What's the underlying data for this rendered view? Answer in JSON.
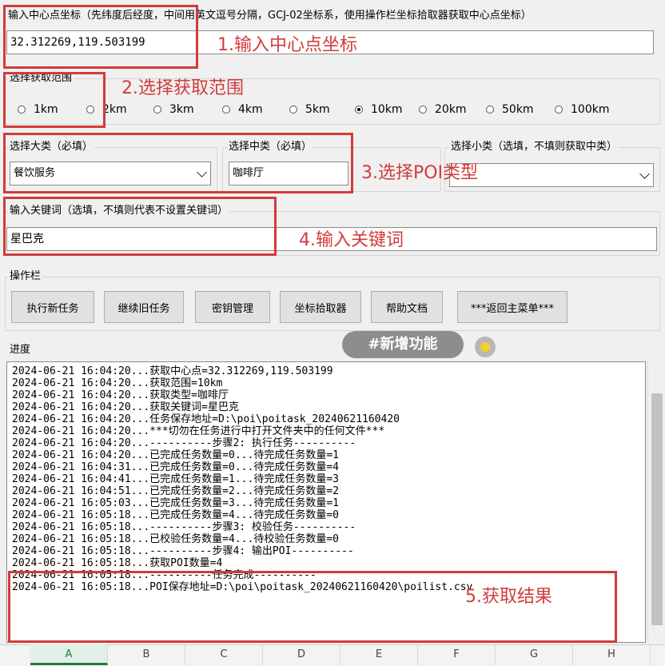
{
  "center": {
    "label": "输入中心点坐标（先纬度后经度，中间用英文逗号分隔，GCJ-02坐标系，使用操作栏坐标拾取器获取中心点坐标）",
    "value": "32.312269,119.503199"
  },
  "range": {
    "label": "选择获取范围",
    "options": [
      "1km",
      "2km",
      "3km",
      "4km",
      "5km",
      "10km",
      "20km",
      "50km",
      "100km"
    ],
    "selected": "10km"
  },
  "poi": {
    "major_label": "选择大类（必填）",
    "major_value": "餐饮服务",
    "middle_label": "选择中类（必填）",
    "middle_value": "咖啡厅",
    "minor_label": "选择小类（选填，不填则获取中类）",
    "minor_value": ""
  },
  "keyword": {
    "label": "输入关键词（选填，不填则代表不设置关键词）",
    "value": "星巴克"
  },
  "toolbar": {
    "label": "操作栏",
    "buttons": [
      "执行新任务",
      "继续旧任务",
      "密钥管理",
      "坐标拾取器",
      "帮助文档",
      "***返回主菜单***"
    ]
  },
  "progress": {
    "label": "进度",
    "lines": [
      "2024-06-21 16:04:20...获取中心点=32.312269,119.503199",
      "2024-06-21 16:04:20...获取范围=10km",
      "2024-06-21 16:04:20...获取类型=咖啡厅",
      "2024-06-21 16:04:20...获取关键词=星巴克",
      "2024-06-21 16:04:20...任务保存地址=D:\\poi\\poitask_20240621160420",
      "2024-06-21 16:04:20...***切勿在任务进行中打开文件夹中的任何文件***",
      "2024-06-21 16:04:20...----------步骤2: 执行任务----------",
      "2024-06-21 16:04:20...已完成任务数量=0...待完成任务数量=1",
      "2024-06-21 16:04:31...已完成任务数量=0...待完成任务数量=4",
      "2024-06-21 16:04:41...已完成任务数量=1...待完成任务数量=3",
      "2024-06-21 16:04:51...已完成任务数量=2...待完成任务数量=2",
      "2024-06-21 16:05:03...已完成任务数量=3...待完成任务数量=1",
      "2024-06-21 16:05:18...已完成任务数量=4...待完成任务数量=0",
      "2024-06-21 16:05:18...----------步骤3: 校验任务----------",
      "2024-06-21 16:05:18...已校验任务数量=4...待校验任务数量=0",
      "2024-06-21 16:05:18...----------步骤4: 输出POI----------",
      "2024-06-21 16:05:18...获取POI数量=4",
      "2024-06-21 16:05:18...----------任务完成----------",
      "2024-06-21 16:05:18...POI保存地址=D:\\poi\\poitask_20240621160420\\poilist.csv"
    ]
  },
  "annotations": {
    "a1": "1.输入中心点坐标",
    "a2": "2.选择获取范围",
    "a3": "3.选择POI类型",
    "a4": "4.输入关键词",
    "a5": "5.获取结果",
    "badge": "#新增功能"
  },
  "sheet_columns": [
    "A",
    "B",
    "C",
    "D",
    "E",
    "F",
    "G",
    "H"
  ],
  "accent": "#d23b3b"
}
